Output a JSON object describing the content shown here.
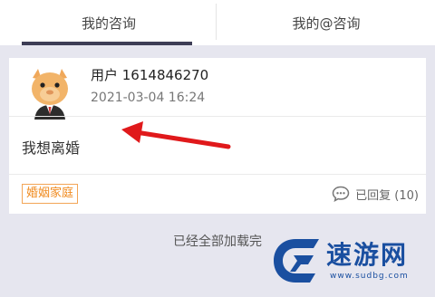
{
  "tabs": [
    {
      "label": "我的咨询",
      "active": true
    },
    {
      "label": "我的@咨询",
      "active": false
    }
  ],
  "post": {
    "username": "用户 1614846270",
    "datetime": "2021-03-04 16:24",
    "question": "我想离婚",
    "tag": "婚姻家庭",
    "reply_status": "已回复 (10)",
    "avatar_icon": "cartoon-avatar-icon",
    "reply_icon": "chat-bubble-icon"
  },
  "footer": {
    "loaded_text": "已经全部加载完"
  },
  "watermark": {
    "brand": "速游网",
    "url": "www.sudbg.com"
  },
  "colors": {
    "tab_indicator": "#3d3d55",
    "tag": "#f08a1e",
    "arrow": "#e0191b",
    "watermark": "#1a4fa0",
    "background": "#e6e6ef"
  }
}
